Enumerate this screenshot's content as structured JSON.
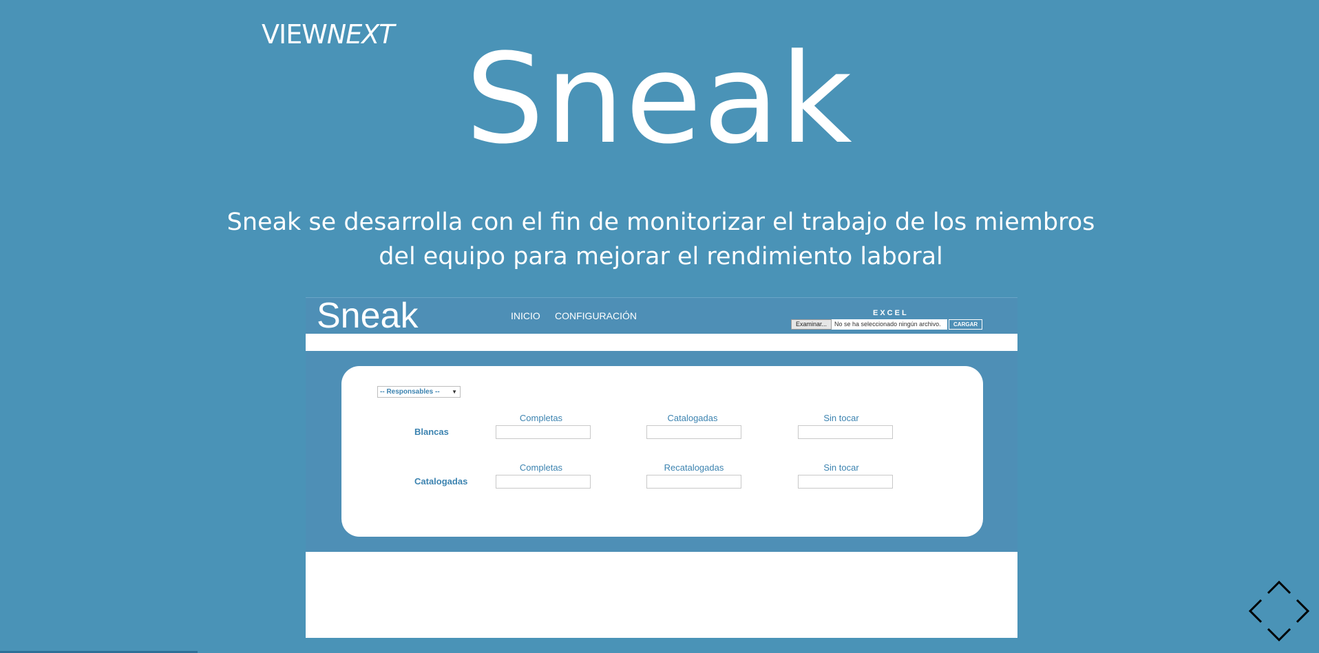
{
  "slide": {
    "logo_plain": "VIEW",
    "logo_emphasis": "NEXT",
    "title": "Sneak",
    "subtitle": "Sneak se desarrolla con el fin de monitorizar el trabajo de los miembros del equipo para mejorar el rendimiento laboral",
    "progress": 0.15
  },
  "app": {
    "brand": "Sneak",
    "nav": [
      "INICIO",
      "CONFIGURACIÓN"
    ],
    "excel_label": "EXCEL",
    "file_button": "Examinar...",
    "file_status": "No se ha seleccionado ningún archivo.",
    "upload_button": "CARGAR",
    "responsables_select": "-- Responsables --",
    "rows": [
      {
        "label": "Blancas",
        "columns": [
          "Completas",
          "Catalogadas",
          "Sin tocar"
        ]
      },
      {
        "label": "Catalogadas",
        "columns": [
          "Completas",
          "Recatalogadas",
          "Sin tocar"
        ]
      }
    ]
  },
  "colors": {
    "background": "#4a93b7",
    "app_header": "#4e8fb6",
    "label_blue": "#3c83b0"
  },
  "icons": {
    "navigation": "chevron-arrows-icon"
  }
}
